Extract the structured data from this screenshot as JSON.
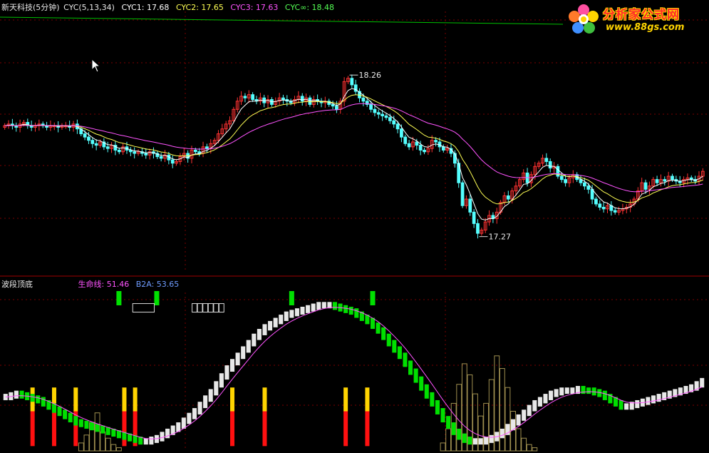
{
  "top_panel": {
    "stock_name": "新天科技(5分钟)",
    "indicator": "CYC(5,13,34)",
    "cyc1_label": "CYC1: 17.68",
    "cyc2_label": "CYC2: 17.65",
    "cyc3_label": "CYC3: 17.63",
    "cycinf_label": "CYC∞: 18.48"
  },
  "bottom_panel": {
    "indicator_name": "波段顶底",
    "lifeline_label": "生命线: 51.46",
    "b2a_label": "B2A: 53.65"
  },
  "logo": {
    "title": "分析家公式网",
    "url": "www.88gs.com"
  },
  "colors": {
    "background": "#000000",
    "grid": "#7a0000",
    "up": "#ff3232",
    "down": "#54ffff",
    "cyc1": "#ffffff",
    "cyc2": "#ffff54",
    "cyc3": "#ff54ff",
    "cycinf": "#00c000",
    "lifeline": "#ff54ff",
    "b2a": "#5b8cff",
    "uptrend_bar": "#e8e8e8",
    "downtrend_bar": "#00e000",
    "buy_signal": "#00e000",
    "top_marker": "#ffd400",
    "bottom_marker": "#ff1010",
    "volume_outline": "#a09050"
  },
  "chart_data": [
    {
      "type": "candlestick",
      "title": "新天科技(5分钟)",
      "series": [
        {
          "name": "CYC1",
          "value": 17.68
        },
        {
          "name": "CYC2",
          "value": 17.65
        },
        {
          "name": "CYC3",
          "value": 17.63
        },
        {
          "name": "CYC∞",
          "value": 18.48
        }
      ],
      "ylim": [
        17.05,
        18.65
      ],
      "max_marker": {
        "label": "18.26",
        "value": 18.26
      },
      "min_marker": {
        "label": "17.27",
        "value": 17.27
      },
      "closes": [
        17.95,
        17.96,
        17.95,
        17.94,
        17.96,
        17.97,
        17.95,
        17.94,
        17.95,
        17.96,
        17.95,
        17.94,
        17.95,
        17.95,
        17.94,
        17.95,
        17.95,
        17.94,
        17.96,
        17.93,
        17.9,
        17.88,
        17.86,
        17.84,
        17.83,
        17.85,
        17.82,
        17.81,
        17.83,
        17.8,
        17.79,
        17.82,
        17.8,
        17.79,
        17.78,
        17.79,
        17.78,
        17.77,
        17.79,
        17.78,
        17.76,
        17.75,
        17.77,
        17.74,
        17.72,
        17.73,
        17.76,
        17.78,
        17.75,
        17.8,
        17.79,
        17.78,
        17.82,
        17.81,
        17.84,
        17.86,
        17.9,
        17.93,
        17.96,
        17.98,
        18.05,
        18.1,
        18.13,
        18.12,
        18.14,
        18.11,
        18.1,
        18.12,
        18.09,
        18.11,
        18.08,
        18.1,
        18.12,
        18.11,
        18.1,
        18.09,
        18.11,
        18.13,
        18.1,
        18.12,
        18.08,
        18.11,
        18.1,
        18.09,
        18.1,
        18.08,
        18.07,
        18.05,
        18.1,
        18.22,
        18.24,
        18.2,
        18.16,
        18.12,
        18.1,
        18.08,
        18.05,
        18.03,
        18.02,
        18.01,
        18.0,
        17.98,
        17.96,
        17.93,
        17.88,
        17.84,
        17.82,
        17.85,
        17.83,
        17.8,
        17.79,
        17.81,
        17.86,
        17.85,
        17.82,
        17.8,
        17.81,
        17.78,
        17.72,
        17.6,
        17.46,
        17.5,
        17.42,
        17.35,
        17.29,
        17.31,
        17.36,
        17.4,
        17.38,
        17.42,
        17.48,
        17.52,
        17.5,
        17.55,
        17.58,
        17.62,
        17.66,
        17.6,
        17.65,
        17.7,
        17.72,
        17.75,
        17.73,
        17.69,
        17.7,
        17.64,
        17.62,
        17.6,
        17.63,
        17.65,
        17.62,
        17.6,
        17.58,
        17.56,
        17.5,
        17.47,
        17.45,
        17.44,
        17.46,
        17.43,
        17.42,
        17.43,
        17.44,
        17.45,
        17.47,
        17.5,
        17.55,
        17.6,
        17.56,
        17.58,
        17.62,
        17.6,
        17.62,
        17.61,
        17.64,
        17.62,
        17.61,
        17.6,
        17.62,
        17.63,
        17.62,
        17.61,
        17.64,
        17.67
      ]
    },
    {
      "type": "bar",
      "title": "波段顶底",
      "series": [
        {
          "name": "生命线",
          "value": 51.46
        },
        {
          "name": "B2A",
          "value": 53.65
        }
      ],
      "ylim": [
        0,
        100
      ],
      "trend_values": [
        34,
        35,
        36,
        35,
        34,
        33,
        32,
        30,
        28,
        26,
        24,
        22,
        20,
        18,
        17,
        16,
        15,
        14,
        13,
        12,
        11,
        10,
        9,
        8,
        7,
        6,
        6,
        7,
        8,
        10,
        12,
        14,
        16,
        19,
        22,
        25,
        29,
        33,
        37,
        42,
        47,
        52,
        56,
        60,
        64,
        68,
        72,
        75,
        78,
        80,
        82,
        84,
        86,
        87,
        88,
        89,
        90,
        91,
        92,
        92,
        92,
        91,
        90,
        89,
        88,
        86,
        84,
        82,
        79,
        76,
        72,
        68,
        64,
        60,
        55,
        50,
        45,
        40,
        35,
        30,
        25,
        20,
        16,
        12,
        9,
        7,
        6,
        6,
        6,
        7,
        8,
        10,
        12,
        15,
        18,
        21,
        24,
        27,
        30,
        32,
        34,
        36,
        37,
        38,
        38,
        38,
        39,
        38,
        38,
        37,
        36,
        34,
        32,
        30,
        28,
        28,
        29,
        30,
        31,
        32,
        33,
        34,
        35,
        36,
        37,
        38,
        39,
        40,
        42,
        44
      ],
      "trend_down": [
        false,
        false,
        false,
        true,
        true,
        true,
        true,
        true,
        true,
        true,
        true,
        true,
        true,
        true,
        true,
        true,
        true,
        true,
        true,
        true,
        true,
        true,
        true,
        true,
        true,
        true,
        false,
        false,
        false,
        false,
        false,
        false,
        false,
        false,
        false,
        false,
        false,
        false,
        false,
        false,
        false,
        false,
        false,
        false,
        false,
        false,
        false,
        false,
        false,
        false,
        false,
        false,
        false,
        false,
        false,
        false,
        false,
        false,
        false,
        false,
        false,
        true,
        true,
        true,
        true,
        true,
        true,
        true,
        true,
        true,
        true,
        true,
        true,
        true,
        true,
        true,
        true,
        true,
        true,
        true,
        true,
        true,
        true,
        true,
        true,
        true,
        true,
        false,
        false,
        false,
        false,
        false,
        false,
        false,
        false,
        false,
        false,
        false,
        false,
        false,
        false,
        false,
        false,
        false,
        false,
        false,
        false,
        true,
        true,
        true,
        true,
        true,
        true,
        true,
        true,
        false,
        false,
        false,
        false,
        false,
        false,
        false,
        false,
        false,
        false,
        false,
        false,
        false,
        false,
        false
      ],
      "buy_signals": [
        21,
        28,
        53,
        68
      ],
      "top_bottom_markers": [
        5,
        9,
        13,
        22,
        24,
        42,
        48,
        63,
        67
      ],
      "volume": [
        0,
        0,
        0,
        0,
        0,
        0,
        0,
        0,
        0,
        0,
        0,
        0,
        0,
        0,
        5,
        10,
        18,
        24,
        12,
        8,
        4,
        2,
        0,
        0,
        0,
        0,
        0,
        0,
        0,
        0,
        0,
        0,
        0,
        0,
        0,
        0,
        0,
        0,
        0,
        0,
        0,
        0,
        0,
        0,
        0,
        0,
        0,
        0,
        0,
        0,
        0,
        0,
        0,
        0,
        0,
        0,
        0,
        0,
        0,
        0,
        0,
        0,
        0,
        0,
        0,
        0,
        0,
        0,
        0,
        0,
        0,
        0,
        0,
        0,
        0,
        0,
        0,
        0,
        0,
        0,
        0,
        5,
        14,
        30,
        42,
        55,
        48,
        36,
        22,
        30,
        45,
        60,
        52,
        40,
        25,
        14,
        8,
        4,
        2,
        0,
        0,
        0,
        0,
        0,
        0,
        0,
        0,
        0,
        0,
        0,
        0,
        0,
        0,
        0,
        0,
        0,
        0,
        0,
        0,
        0,
        0,
        0,
        0,
        0,
        0,
        0,
        0,
        0,
        0,
        0
      ]
    }
  ]
}
